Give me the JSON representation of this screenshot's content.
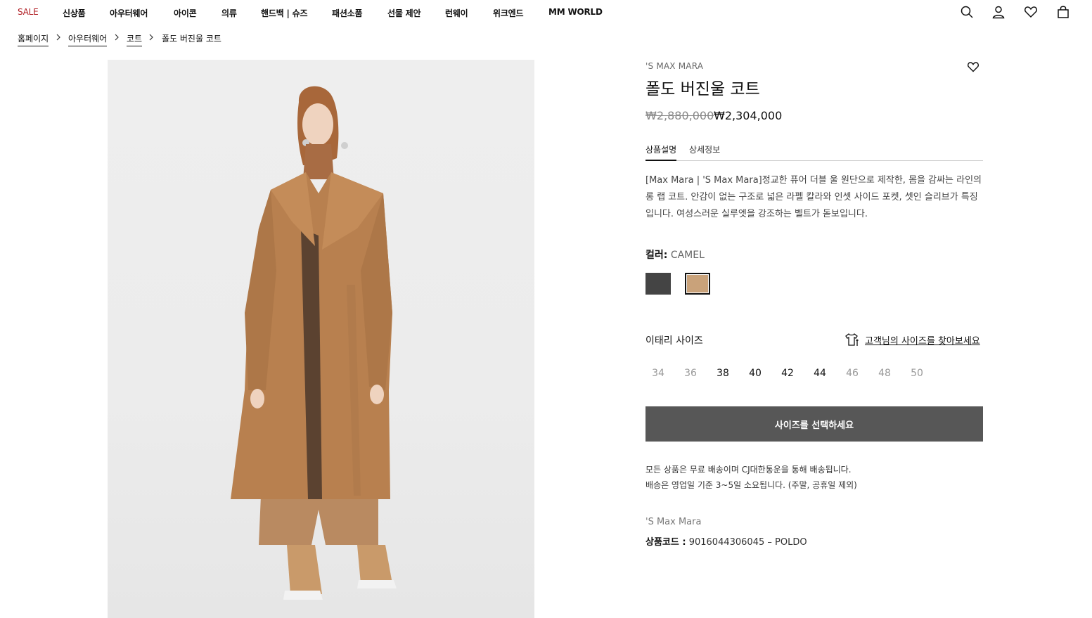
{
  "nav": {
    "items": [
      "SALE",
      "신상품",
      "아우터웨어",
      "아이콘",
      "의류",
      "핸드백 | 슈즈",
      "패션소품",
      "선물 제안",
      "런웨이",
      "위크엔드",
      "MM WORLD"
    ],
    "icons": [
      "search-icon",
      "account-icon",
      "wishlist-icon",
      "bag-icon"
    ],
    "sale_color": "#b01c22"
  },
  "breadcrumb": [
    "홈페이지",
    "아우터웨어",
    "코트",
    "폴도 버진울 코트"
  ],
  "product": {
    "brand": "'S MAX MARA",
    "title": "폴도 버진울 코트",
    "price_original": "₩2,880,000",
    "price_sale": "₩2,304,000",
    "tabs": [
      "상품설명",
      "상세정보"
    ],
    "active_tab": "상품설명",
    "description": "[Max Mara | 'S Max Mara]정교한 퓨어 더블 울 원단으로 제작한, 몸을 감싸는 라인의 롱 랩 코트. 안감이 없는 구조로 넓은 라펠 칼라와 인셋 사이드 포켓, 셋인 슬리브가 특징입니다. 여성스러운 실루엣을 강조하는 벨트가 돋보입니다.",
    "color_label": "컬러:",
    "color_value": "CAMEL",
    "swatches": [
      {
        "name": "charcoal",
        "color": "#444444",
        "selected": false
      },
      {
        "name": "camel",
        "color": "#c9a27a",
        "selected": true
      }
    ],
    "size_label": "이태리 사이즈",
    "size_guide": "고객님의 사이즈를 찾아보세요",
    "sizes": [
      {
        "label": "34",
        "available": false
      },
      {
        "label": "36",
        "available": false
      },
      {
        "label": "38",
        "available": true
      },
      {
        "label": "40",
        "available": true
      },
      {
        "label": "42",
        "available": true
      },
      {
        "label": "44",
        "available": true
      },
      {
        "label": "46",
        "available": false
      },
      {
        "label": "48",
        "available": false
      },
      {
        "label": "50",
        "available": false
      }
    ],
    "cta": "사이즈를 선택하세요",
    "shipping_line1": "모든 상품은 무료 배송이며 CJ대한통운을 통해 배송됩니다.",
    "shipping_line2": "배송은 영업일 기준 3~5일 소요됩니다. (주말, 공휴일 제외)",
    "brand_line": "'S Max Mara",
    "code_label": "상품코드 :",
    "code_value": "9016044306045 – POLDO"
  }
}
